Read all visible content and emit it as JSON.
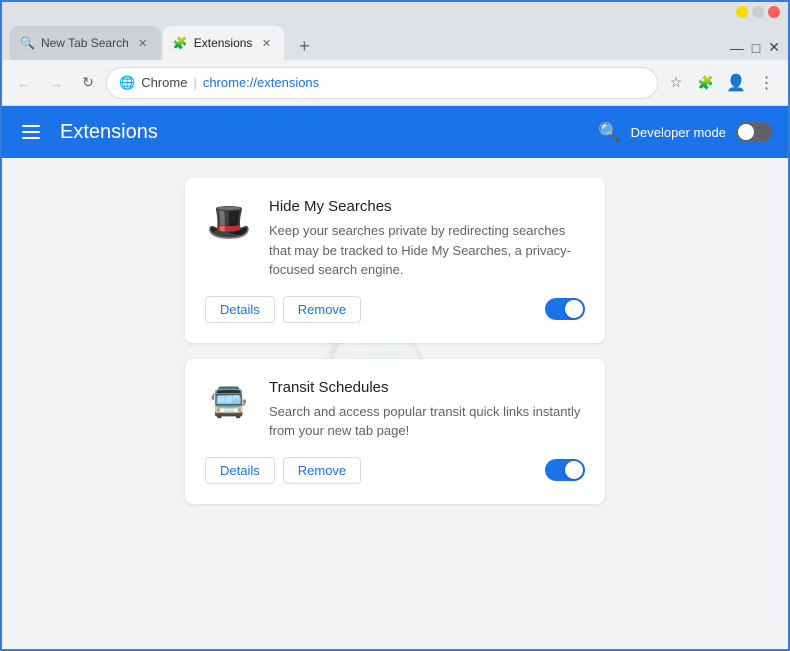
{
  "browser": {
    "tabs": [
      {
        "id": "tab1",
        "title": "New Tab Search",
        "icon": "🔍",
        "active": false,
        "closable": true
      },
      {
        "id": "tab2",
        "title": "Extensions",
        "icon": "🧩",
        "active": true,
        "closable": true
      }
    ],
    "new_tab_label": "+",
    "nav": {
      "back_label": "←",
      "forward_label": "→",
      "reload_label": "↻",
      "address_icon": "globe",
      "address_site": "Chrome",
      "address_separator": "|",
      "address_url": "chrome://extensions",
      "bookmark_label": "☆",
      "minimize_label": "—",
      "maximize_label": "□",
      "close_label": "✕"
    }
  },
  "extensions_page": {
    "header": {
      "menu_label": "menu",
      "title": "Extensions",
      "search_label": "search",
      "dev_mode_label": "Developer mode",
      "dev_mode_on": false
    },
    "extensions": [
      {
        "id": "ext1",
        "icon": "🎩",
        "name": "Hide My Searches",
        "description": "Keep your searches private by redirecting searches that may be tracked to Hide My Searches, a privacy-focused search engine.",
        "details_label": "Details",
        "remove_label": "Remove",
        "enabled": true
      },
      {
        "id": "ext2",
        "icon": "🚌",
        "name": "Transit Schedules",
        "description": "Search and access popular transit quick links instantly from your new tab page!",
        "details_label": "Details",
        "remove_label": "Remove",
        "enabled": true
      }
    ]
  }
}
